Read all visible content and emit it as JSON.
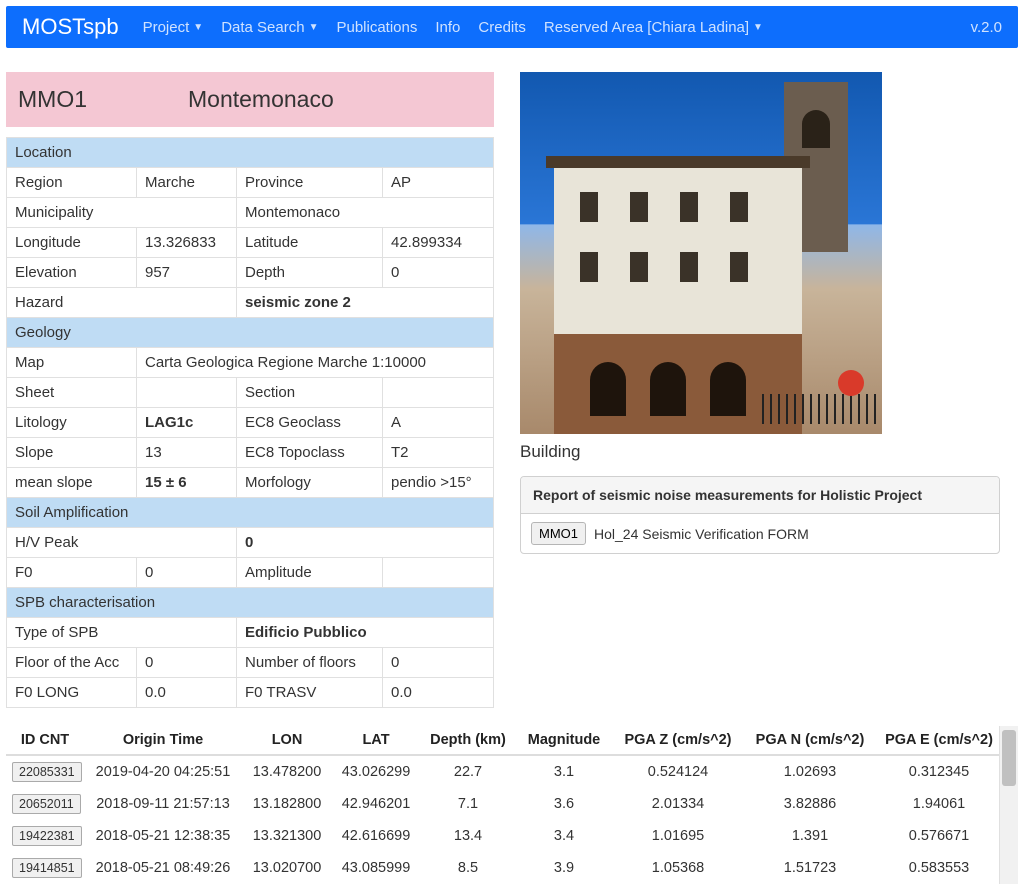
{
  "nav": {
    "brand": "MOSTspb",
    "items": [
      {
        "label": "Project",
        "dropdown": true
      },
      {
        "label": "Data Search",
        "dropdown": true
      },
      {
        "label": "Publications",
        "dropdown": false
      },
      {
        "label": "Info",
        "dropdown": false
      },
      {
        "label": "Credits",
        "dropdown": false
      },
      {
        "label": "Reserved Area [Chiara Ladina]",
        "dropdown": true
      }
    ],
    "version": "v.2.0"
  },
  "site": {
    "code": "MMO1",
    "name": "Montemonaco"
  },
  "location": {
    "section": "Location",
    "region_label": "Region",
    "region": "Marche",
    "province_label": "Province",
    "province": "AP",
    "municipality_label": "Municipality",
    "municipality": "Montemonaco",
    "longitude_label": "Longitude",
    "longitude": "13.326833",
    "latitude_label": "Latitude",
    "latitude": "42.899334",
    "elevation_label": "Elevation",
    "elevation": "957",
    "depth_label": "Depth",
    "depth": "0",
    "hazard_label": "Hazard",
    "hazard": "seismic zone 2"
  },
  "geology": {
    "section": "Geology",
    "map_label": "Map",
    "map": "Carta Geologica Regione Marche 1:10000",
    "sheet_label": "Sheet",
    "sheet": "",
    "section_label": "Section",
    "section_val": "",
    "litology_label": "Litology",
    "litology": "LAG1c",
    "ec8geo_label": "EC8 Geoclass",
    "ec8geo": "A",
    "slope_label": "Slope",
    "slope": "13",
    "ec8topo_label": "EC8 Topoclass",
    "ec8topo": "T2",
    "meanslope_label": "mean slope",
    "meanslope": "15 ± 6",
    "morfology_label": "Morfology",
    "morfology": "pendio >15°"
  },
  "soil": {
    "section": "Soil Amplification",
    "hvpeak_label": "H/V Peak",
    "hvpeak": "0",
    "f0_label": "F0",
    "f0": "0",
    "amp_label": "Amplitude",
    "amp": ""
  },
  "spb": {
    "section": "SPB characterisation",
    "type_label": "Type of SPB",
    "type": "Edificio Pubblico",
    "flooracc_label": "Floor of the Acc",
    "flooracc": "0",
    "numfloor_label": "Number of floors",
    "numfloor": "0",
    "f0long_label": "F0 LONG",
    "f0long": "0.0",
    "f0trasv_label": "F0 TRASV",
    "f0trasv": "0.0"
  },
  "building_caption": "Building",
  "report": {
    "title": "Report of seismic noise measurements for Holistic Project",
    "button": "MMO1",
    "link": "Hol_24 Seismic Verification FORM"
  },
  "events": {
    "headers": {
      "id": "ID CNT",
      "origin": "Origin Time",
      "lon": "LON",
      "lat": "LAT",
      "depth": "Depth (km)",
      "mag": "Magnitude",
      "pgaz": "PGA Z (cm/s^2)",
      "pgan": "PGA N (cm/s^2)",
      "pgae": "PGA E (cm/s^2)"
    },
    "rows": [
      {
        "id": "22085331",
        "origin": "2019-04-20 04:25:51",
        "lon": "13.478200",
        "lat": "43.026299",
        "depth": "22.7",
        "mag": "3.1",
        "pgaz": "0.524124",
        "pgan": "1.02693",
        "pgae": "0.312345"
      },
      {
        "id": "20652011",
        "origin": "2018-09-11 21:57:13",
        "lon": "13.182800",
        "lat": "42.946201",
        "depth": "7.1",
        "mag": "3.6",
        "pgaz": "2.01334",
        "pgan": "3.82886",
        "pgae": "1.94061"
      },
      {
        "id": "19422381",
        "origin": "2018-05-21 12:38:35",
        "lon": "13.321300",
        "lat": "42.616699",
        "depth": "13.4",
        "mag": "3.4",
        "pgaz": "1.01695",
        "pgan": "1.391",
        "pgae": "0.576671"
      },
      {
        "id": "19414851",
        "origin": "2018-05-21 08:49:26",
        "lon": "13.020700",
        "lat": "43.085999",
        "depth": "8.5",
        "mag": "3.9",
        "pgaz": "1.05368",
        "pgan": "1.51723",
        "pgae": "0.583553"
      }
    ]
  }
}
